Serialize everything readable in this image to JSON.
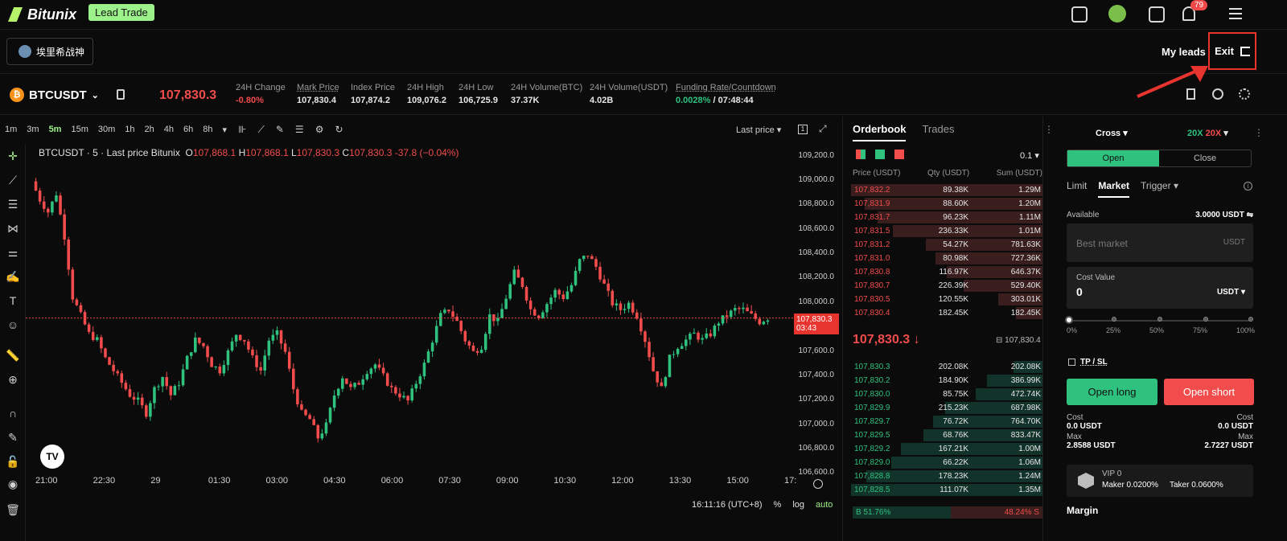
{
  "header": {
    "brand": "Bitunix",
    "lead_trade_label": "Lead Trade",
    "notification_count": "79",
    "username": "埃里希战神",
    "my_leads_label": "My leads",
    "exit_label": "Exit"
  },
  "ticker": {
    "symbol": "BTCUSDT",
    "last_price": "107,830.3",
    "stats": [
      {
        "label": "24H Change",
        "value": "-0.80%",
        "color": "#f24c4c"
      },
      {
        "label": "Mark Price",
        "value": "107,830.4",
        "color": "#e6e6e6"
      },
      {
        "label": "Index Price",
        "value": "107,874.2",
        "color": "#e6e6e6"
      },
      {
        "label": "24H High",
        "value": "109,076.2",
        "color": "#e6e6e6"
      },
      {
        "label": "24H Low",
        "value": "106,725.9",
        "color": "#e6e6e6"
      },
      {
        "label": "24H Volume(BTC)",
        "value": "37.37K",
        "color": "#e6e6e6"
      },
      {
        "label": "24H Volume(USDT)",
        "value": "4.02B",
        "color": "#e6e6e6"
      }
    ],
    "funding_label": "Funding Rate/Countdown",
    "funding_rate": "0.0028%",
    "countdown": "/ 07:48:44"
  },
  "chart_toolbar": {
    "timeframes": [
      "1m",
      "3m",
      "5m",
      "15m",
      "30m",
      "1h",
      "2h",
      "4h",
      "6h",
      "8h"
    ],
    "active_timeframe": "5m",
    "price_source": "Last price"
  },
  "chart_legend": {
    "title": "BTCUSDT · 5 · Last price Bitunix",
    "o": "107,868.1",
    "h": "107,868.1",
    "l": "107,830.3",
    "c": "107,830.3",
    "change": "-37.8 (−0.04%)"
  },
  "chart_data": {
    "type": "candlestick",
    "y_ticks": [
      "109,200.0",
      "109,000.0",
      "108,800.0",
      "108,600.0",
      "108,400.0",
      "108,200.0",
      "108,000.0",
      "107,800.0",
      "107,600.0",
      "107,400.0",
      "107,200.0",
      "107,000.0",
      "106,800.0",
      "106,600.0"
    ],
    "ylim": [
      106550,
      109250
    ],
    "x_ticks": [
      "21:00",
      "22:30",
      "29",
      "01:30",
      "03:00",
      "04:30",
      "06:00",
      "07:30",
      "09:00",
      "10:30",
      "12:00",
      "13:30",
      "15:00",
      "17:"
    ],
    "current_price_tag": "107,830.3",
    "countdown_tag": "03:43",
    "close_path": [
      108950,
      108800,
      108700,
      108850,
      108500,
      108000,
      107850,
      107700,
      107650,
      107500,
      107400,
      107300,
      107200,
      107150,
      107050,
      107250,
      107350,
      107200,
      107300,
      107500,
      107650,
      107600,
      107450,
      107400,
      107550,
      107700,
      107650,
      107500,
      107400,
      107650,
      107700,
      107550,
      107250,
      107050,
      107000,
      106850,
      106950,
      107200,
      107350,
      107250,
      107300,
      107400,
      107450,
      107350,
      107250,
      107200,
      107150,
      107300,
      107450,
      107650,
      107850,
      107900,
      107800,
      107650,
      107550,
      107600,
      107850,
      107800,
      108000,
      108200,
      108100,
      107900,
      107850,
      107950,
      108050,
      108000,
      108100,
      108300,
      108350,
      108250,
      108100,
      107950,
      107900,
      107950,
      107850,
      107650,
      107400,
      107250,
      107500,
      107600,
      107650,
      107700,
      107650,
      107700,
      107800,
      107850,
      107900,
      107900,
      107850,
      107800,
      107830
    ]
  },
  "chart_footer": {
    "time": "16:11:16 (UTC+8)",
    "pct": "%",
    "log": "log",
    "auto": "auto"
  },
  "orderbook": {
    "tab_orderbook": "Orderbook",
    "tab_trades": "Trades",
    "group": "0.1",
    "col_price": "Price (USDT)",
    "col_qty": "Qty (USDT)",
    "col_sum": "Sum (USDT)",
    "asks": [
      {
        "p": "107,832.2",
        "q": "89.38K",
        "s": "1.29M",
        "d": 1.0
      },
      {
        "p": "107,831.9",
        "q": "88.60K",
        "s": "1.20M",
        "d": 0.93
      },
      {
        "p": "107,831.7",
        "q": "96.23K",
        "s": "1.11M",
        "d": 0.86
      },
      {
        "p": "107,831.5",
        "q": "236.33K",
        "s": "1.01M",
        "d": 0.78
      },
      {
        "p": "107,831.2",
        "q": "54.27K",
        "s": "781.63K",
        "d": 0.61
      },
      {
        "p": "107,831.0",
        "q": "80.98K",
        "s": "727.36K",
        "d": 0.56
      },
      {
        "p": "107,830.8",
        "q": "116.97K",
        "s": "646.37K",
        "d": 0.5
      },
      {
        "p": "107,830.7",
        "q": "226.39K",
        "s": "529.40K",
        "d": 0.41
      },
      {
        "p": "107,830.5",
        "q": "120.55K",
        "s": "303.01K",
        "d": 0.23
      },
      {
        "p": "107,830.4",
        "q": "182.45K",
        "s": "182.45K",
        "d": 0.14
      }
    ],
    "mid_price": "107,830.3 ↓",
    "mark_price": "107,830.4",
    "bids": [
      {
        "p": "107,830.3",
        "q": "202.08K",
        "s": "202.08K",
        "d": 0.15
      },
      {
        "p": "107,830.2",
        "q": "184.90K",
        "s": "386.99K",
        "d": 0.29
      },
      {
        "p": "107,830.0",
        "q": "85.75K",
        "s": "472.74K",
        "d": 0.35
      },
      {
        "p": "107,829.9",
        "q": "215.23K",
        "s": "687.98K",
        "d": 0.51
      },
      {
        "p": "107,829.7",
        "q": "76.72K",
        "s": "764.70K",
        "d": 0.57
      },
      {
        "p": "107,829.5",
        "q": "68.76K",
        "s": "833.47K",
        "d": 0.62
      },
      {
        "p": "107,829.2",
        "q": "167.21K",
        "s": "1.00M",
        "d": 0.74
      },
      {
        "p": "107,829.0",
        "q": "66.22K",
        "s": "1.06M",
        "d": 0.79
      },
      {
        "p": "107,828.8",
        "q": "178.23K",
        "s": "1.24M",
        "d": 0.92
      },
      {
        "p": "107,828.5",
        "q": "111.07K",
        "s": "1.35M",
        "d": 1.0
      }
    ],
    "buy_ratio": "51.76%",
    "sell_ratio": "48.24%",
    "buy_fraction": 0.5176
  },
  "trade": {
    "margin_mode": "Cross",
    "lev_long": "20X",
    "lev_short": "20X",
    "open_label": "Open",
    "close_label": "Close",
    "order_types": [
      "Limit",
      "Market",
      "Trigger"
    ],
    "active_order_type": "Market",
    "available_label": "Available",
    "available_value": "3.0000 USDT",
    "price_placeholder": "Best market",
    "price_unit": "USDT",
    "cost_label": "Cost Value",
    "cost_value": "0",
    "cost_unit": "USDT",
    "percents": [
      "0%",
      "25%",
      "50%",
      "75%",
      "100%"
    ],
    "tpsl_label": "TP / SL",
    "open_long": "Open long",
    "open_short": "Open short",
    "cost_l": "Cost",
    "cost_lv": "0.0 USDT",
    "cost_r": "Cost",
    "cost_rv": "0.0 USDT",
    "max_l": "Max",
    "max_lv": "2.8588 USDT",
    "max_r": "Max",
    "max_rv": "2.7227 USDT",
    "vip_level": "VIP 0",
    "maker_fee": "Maker 0.0200%",
    "taker_fee": "Taker 0.0600%",
    "margin_label": "Margin"
  },
  "colors": {
    "up": "#2ec27e",
    "down": "#f24c4c",
    "accent": "#9df18a",
    "highlight": "#e8342e"
  }
}
